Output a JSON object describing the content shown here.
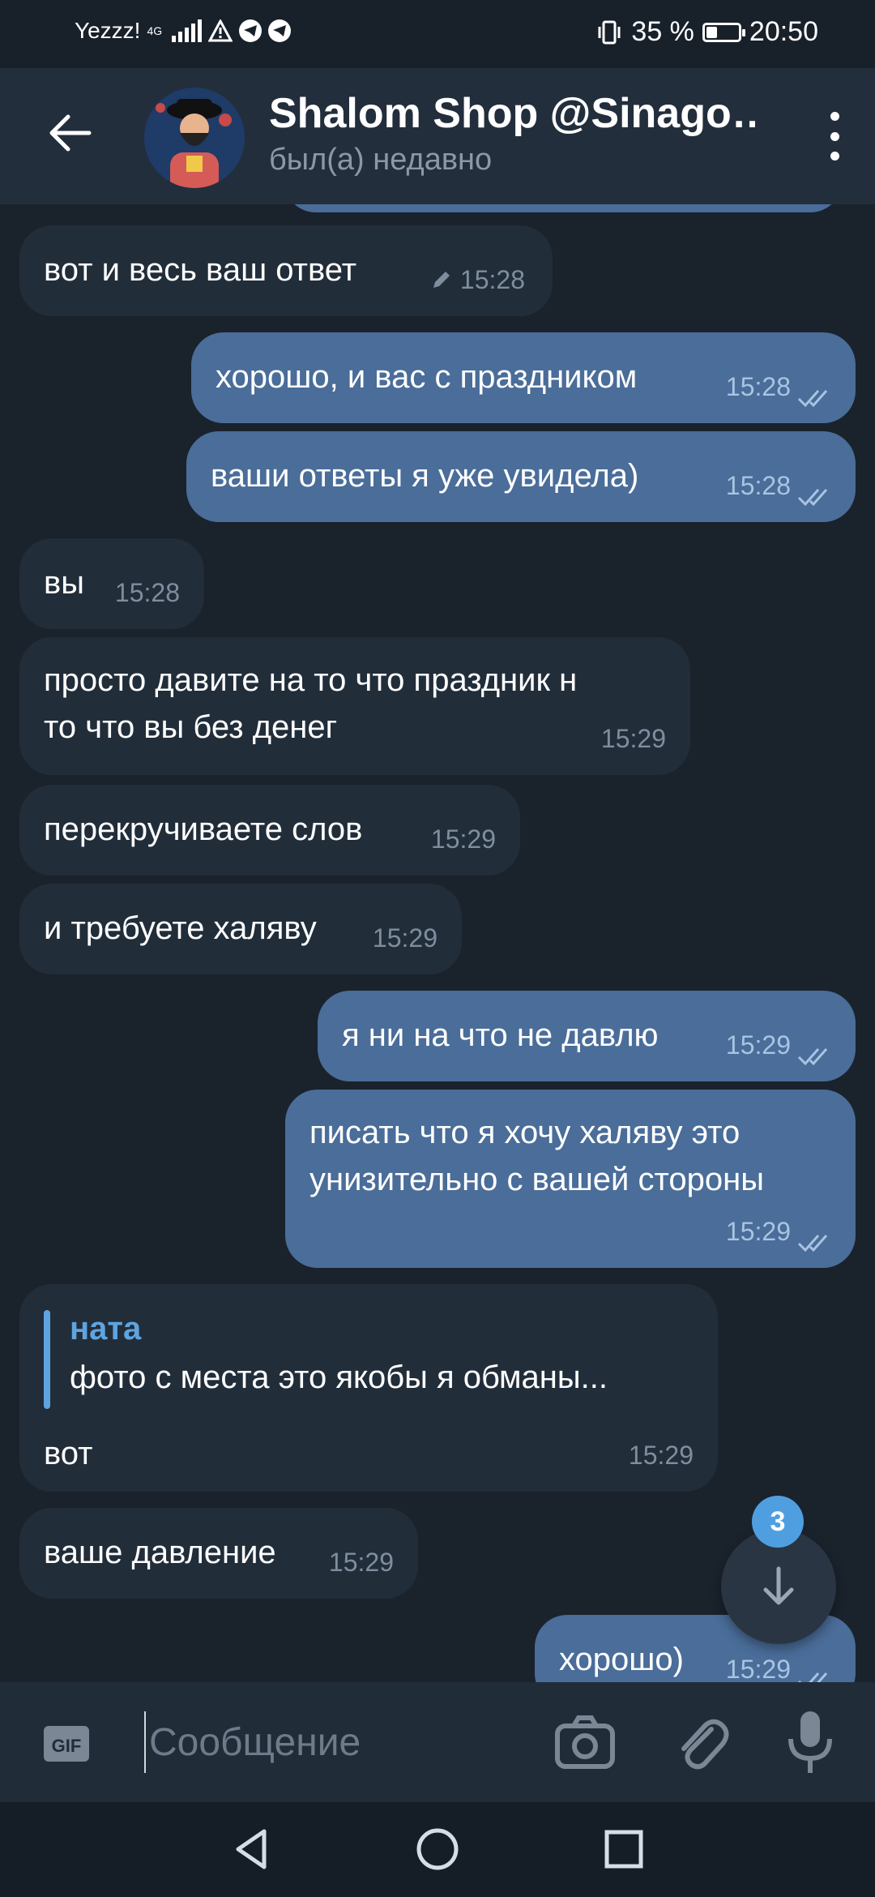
{
  "status_bar": {
    "carrier": "Yezzz!",
    "network": "4G",
    "battery": "35 %",
    "battery_level": 0.35,
    "time": "20:50"
  },
  "header": {
    "title": "Shalom Shop @Sinago…",
    "subtitle": "был(а) недавно"
  },
  "messages": [
    {
      "dir": "in",
      "text": "вот и весь ваш ответ",
      "time": "15:28",
      "edited": true
    },
    {
      "dir": "out",
      "text": "хорошо, и вас с праздником",
      "time": "15:28",
      "read": true
    },
    {
      "dir": "out",
      "text": "ваши ответы я уже увидела)",
      "time": "15:28",
      "read": true
    },
    {
      "dir": "in",
      "text": "вы",
      "time": "15:28"
    },
    {
      "dir": "in",
      "text_lines": [
        "просто давите на то что праздник н",
        "то что вы без денег"
      ],
      "time": "15:29"
    },
    {
      "dir": "in",
      "text": "перекручиваете слов",
      "time": "15:29"
    },
    {
      "dir": "in",
      "text": "и требуете халяву",
      "time": "15:29"
    },
    {
      "dir": "out",
      "text": "я ни на что не давлю",
      "time": "15:29",
      "read": true
    },
    {
      "dir": "out",
      "text_lines": [
        "писать что я хочу халяву это",
        "унизительно с вашей стороны"
      ],
      "time": "15:29",
      "read": true
    },
    {
      "dir": "in",
      "reply": {
        "name": "ната",
        "text": "фото с места это якобы я обманы..."
      },
      "text": "вот",
      "time": "15:29"
    },
    {
      "dir": "in",
      "text": "ваше давление",
      "time": "15:29"
    },
    {
      "dir": "out",
      "text": "хорошо)",
      "time": "15:29",
      "read": true
    }
  ],
  "scroll_button": {
    "unread_count": "3"
  },
  "composer": {
    "placeholder": "Сообщение"
  },
  "colors": {
    "background": "#1a222c",
    "header": "#232e3c",
    "incoming_bubble": "#222d3a",
    "outgoing_bubble": "#4a6d99",
    "accent": "#5ea4e0"
  },
  "icons": [
    "back-arrow-icon",
    "more-vert-icon",
    "gif-icon",
    "camera-icon",
    "attach-icon",
    "mic-icon",
    "arrow-down-icon",
    "double-check-icon",
    "pencil-icon"
  ]
}
